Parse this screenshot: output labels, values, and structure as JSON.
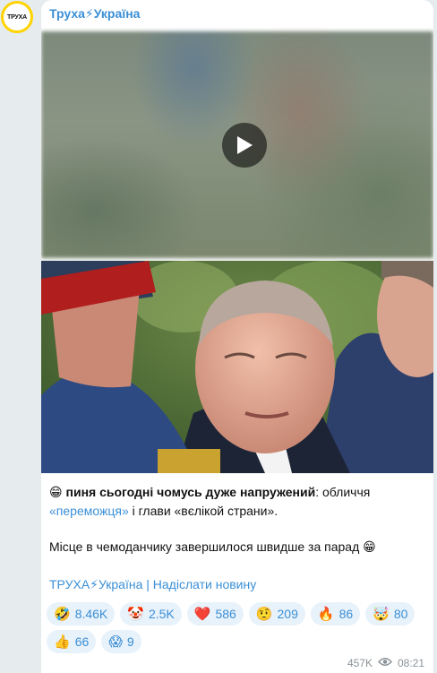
{
  "avatar": {
    "text": "ТРУХА",
    "ring_color": "#ffd400"
  },
  "channel": {
    "name": "Труха⚡Україна"
  },
  "media": {
    "video_play_icon": "play-icon"
  },
  "caption": {
    "line1_emoji": "😁",
    "line1_bold": "пиня сьогодні чомусь дуже напружений",
    "line1_rest": ": обличчя",
    "link_word": "«переможця»",
    "line2_rest": " і глави «вєлікой страни».",
    "line3": "Місце в чемоданчику завершилося швидше за парад",
    "line3_emoji": "😁"
  },
  "footer": {
    "text": "ТРУХА⚡Україна | Надіслати новину"
  },
  "reactions": [
    {
      "emoji": "🤣",
      "count": "8.46K"
    },
    {
      "emoji": "🤡",
      "count": "2.5K"
    },
    {
      "emoji": "❤️",
      "count": "586"
    },
    {
      "emoji": "🤨",
      "count": "209"
    },
    {
      "emoji": "🔥",
      "count": "86"
    },
    {
      "emoji": "🤯",
      "count": "80"
    },
    {
      "emoji": "👍",
      "count": "66"
    },
    {
      "emoji": "😱",
      "count": "9"
    }
  ],
  "meta": {
    "views": "457K",
    "views_icon": "eye-icon",
    "time": "08:21"
  },
  "colors": {
    "accent": "#3a8fd6",
    "reaction_bg": "#e8f2fb",
    "page_bg": "#e6ebee"
  }
}
